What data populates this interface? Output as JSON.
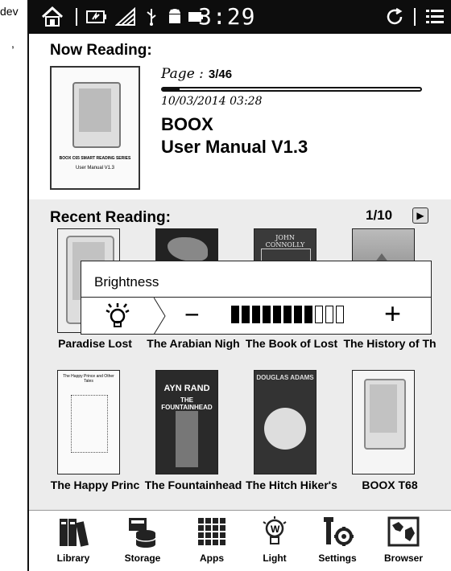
{
  "outside": {
    "top_fragment": "dev",
    "comma": ","
  },
  "status_bar": {
    "time": "3:29",
    "icons": [
      "home-icon",
      "battery-icon",
      "wifi-icon",
      "usb-icon",
      "android-icon",
      "battery-level-icon",
      "sync-icon",
      "menu-icon"
    ]
  },
  "now_reading": {
    "title": "Now Reading:",
    "page_label": "Page :",
    "page_value": "3/46",
    "progress": 0.065,
    "date": "10/03/2014 03:28",
    "book_title_line1": "BOOX",
    "book_title_line2": "User Manual V1.3",
    "cover": {
      "line1": "BOOX C65 SMART READING SERIES",
      "line2": "User Manual V1.3"
    }
  },
  "recent_reading": {
    "title": "Recent Reading:",
    "pager": "1/10",
    "books": [
      {
        "title": "Paradise Lost",
        "cover": "device"
      },
      {
        "title": "The Arabian Nigh",
        "cover": "art"
      },
      {
        "title": "The Book of Lost",
        "cover": "connolly",
        "cover_text": "JOHN CONNOLLY"
      },
      {
        "title": "The History of Th",
        "cover": "landscape"
      },
      {
        "title": "The Happy Princ",
        "cover": "text",
        "cover_text": "The Happy Prince and Other Tales"
      },
      {
        "title": "The Fountainhead",
        "cover": "rand",
        "cover_text_1": "AYN RAND",
        "cover_text_2": "THE FOUNTAINHEAD"
      },
      {
        "title": "The Hitch Hiker's",
        "cover": "hitch",
        "cover_text": "DOUGLAS ADAMS"
      },
      {
        "title": "BOOX T68",
        "cover": "device"
      }
    ]
  },
  "brightness": {
    "title": "Brightness",
    "minus": "−",
    "plus": "+",
    "level": 8,
    "max": 11
  },
  "nav": [
    {
      "label": "Library",
      "icon": "library-icon"
    },
    {
      "label": "Storage",
      "icon": "storage-icon"
    },
    {
      "label": "Apps",
      "icon": "apps-icon"
    },
    {
      "label": "Light",
      "icon": "light-icon"
    },
    {
      "label": "Settings",
      "icon": "settings-icon"
    },
    {
      "label": "Browser",
      "icon": "browser-icon"
    }
  ]
}
